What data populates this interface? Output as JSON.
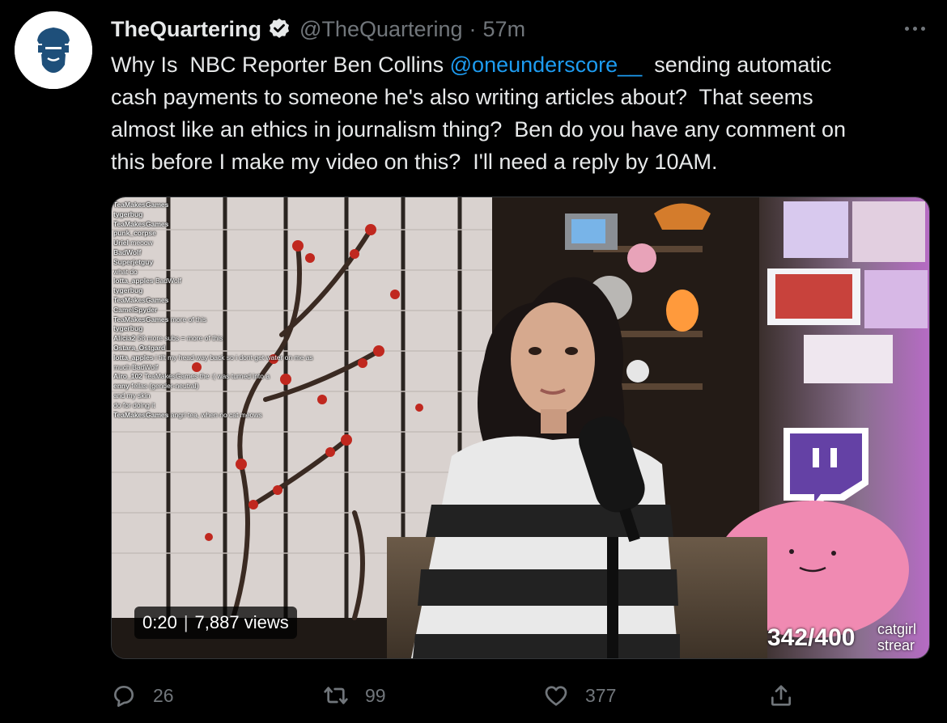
{
  "tweet": {
    "author_name": "TheQuartering",
    "handle": "@TheQuartering",
    "separator": "·",
    "time": "57m",
    "text_lines": [
      {
        "before": "Why Is  NBC Reporter Ben Collins ",
        "mention": "@oneunderscore__",
        "after": "  sending automatic"
      },
      {
        "before": "cash payments to someone he's also writing articles about?  That seems",
        "mention": "",
        "after": ""
      },
      {
        "before": "almost like an ethics in journalism thing?  Ben do you have any comment on",
        "mention": "",
        "after": ""
      },
      {
        "before": "this before I make my video on this?  I'll need a reply by 10AM.",
        "mention": "",
        "after": ""
      }
    ]
  },
  "media": {
    "duration": "0:20",
    "views": "7,887 views",
    "counter": "342/400",
    "overlay_label_lines": [
      "catgirl",
      "strear"
    ],
    "chat_lines": [
      {
        "user": "TeaMakesGames",
        "msg": ""
      },
      {
        "user": "tygerbug",
        "msg": ""
      },
      {
        "user": "TeaMakesGames",
        "msg": ""
      },
      {
        "user": "punk_corpse",
        "msg": ""
      },
      {
        "user": "Uriel",
        "msg": "meoow"
      },
      {
        "user": "",
        "msg": ""
      },
      {
        "user": "BadWolf",
        "msg": ""
      },
      {
        "user": "",
        "msg": ""
      },
      {
        "user": "Superjetguy",
        "msg": ""
      },
      {
        "user": "",
        "msg": ""
      },
      {
        "user": "",
        "msg": ""
      },
      {
        "user": "",
        "msg": "what do"
      },
      {
        "user": "lotta_apples",
        "msg": "BadWolf"
      },
      {
        "user": "",
        "msg": ""
      },
      {
        "user": "",
        "msg": ""
      },
      {
        "user": "",
        "msg": ""
      },
      {
        "user": "tygerbug",
        "msg": ""
      },
      {
        "user": "",
        "msg": ""
      },
      {
        "user": "",
        "msg": ""
      },
      {
        "user": "TeaMakesGames",
        "msg": ""
      },
      {
        "user": "",
        "msg": ""
      },
      {
        "user": "",
        "msg": ""
      },
      {
        "user": "CamelSpyder",
        "msg": ""
      },
      {
        "user": "TeaMakesGames",
        "msg": "more of this"
      },
      {
        "user": "",
        "msg": ""
      },
      {
        "user": "tygerbug",
        "msg": ""
      },
      {
        "user": "Alicia2",
        "msg": "58 more subs = more of this"
      },
      {
        "user": "Ostara_Ostgard",
        "msg": ""
      },
      {
        "user": "lotta_apples",
        "msg": "i tilt my head way back so i dont get water on me as"
      },
      {
        "user": "",
        "msg": "much BadWolf"
      },
      {
        "user": "Airo_102",
        "msg": "TeaMakesGames the :( was turned into a"
      },
      {
        "user": "enny",
        "msg": "fellas (gender-neutral)"
      },
      {
        "user": "",
        "msg": "and my skin"
      },
      {
        "user": "",
        "msg": "do for doing it"
      },
      {
        "user": "",
        "msg": ""
      },
      {
        "user": "TeaMakesGames",
        "msg": "angri tea, when no cat meows"
      }
    ]
  },
  "actions": {
    "reply_count": "26",
    "retweet_count": "99",
    "like_count": "377",
    "icons": [
      "reply-icon",
      "retweet-icon",
      "like-icon",
      "share-icon"
    ]
  },
  "colors": {
    "background": "#000000",
    "text": "#e7e9ea",
    "muted": "#71767b",
    "link": "#1d9bf0",
    "avatar_figure": "#1e4f7a"
  }
}
